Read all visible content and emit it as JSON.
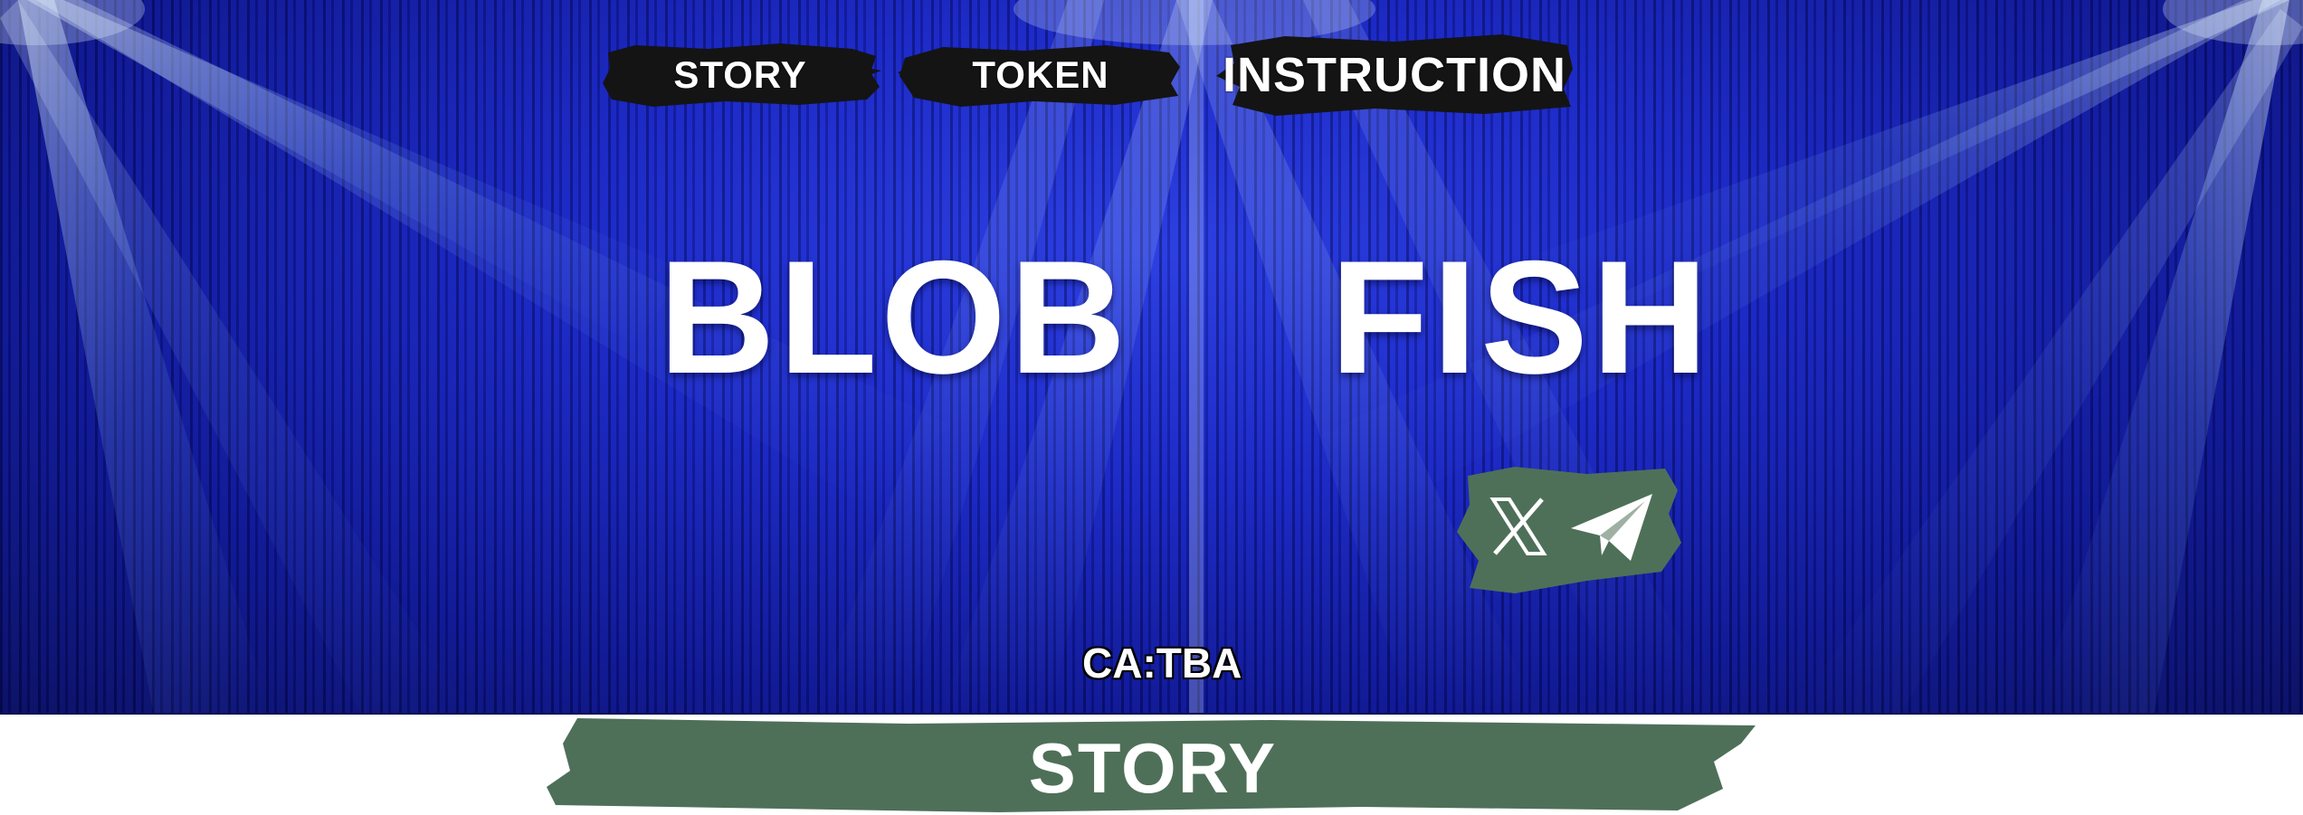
{
  "nav": {
    "story_label": "STORY",
    "token_label": "TOKEN",
    "instruction_label": "INSTRUCTION"
  },
  "hero": {
    "word1": "BLOB",
    "word2": "FISH"
  },
  "socials": {
    "x_icon": "x-logo-icon",
    "telegram_icon": "telegram-icon"
  },
  "contract": {
    "text": "CA:TBA"
  },
  "sections": {
    "story_heading": "STORY"
  },
  "colors": {
    "stage_blue": "#1a27c4",
    "brush_black": "#141414",
    "patch_green": "#4e7058",
    "text_white": "#ffffff"
  }
}
